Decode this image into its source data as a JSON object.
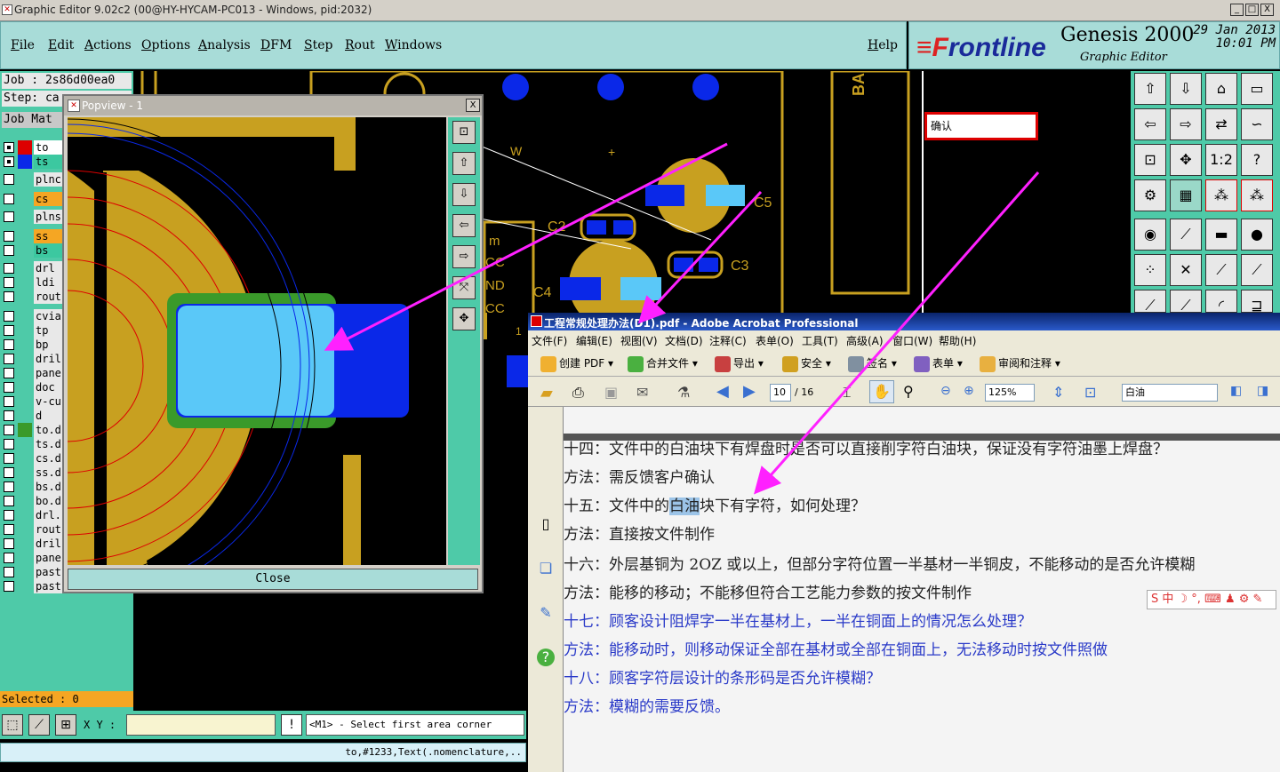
{
  "window": {
    "title": "Graphic Editor 9.02c2 (00@HY-HYCAM-PC013 - Windows, pid:2032)",
    "minimize": "_",
    "maximize": "□",
    "close": "X"
  },
  "menu": {
    "items": [
      "File",
      "Edit",
      "Actions",
      "Options",
      "Analysis",
      "DFM",
      "Step",
      "Rout",
      "Windows"
    ],
    "help": "Help"
  },
  "brand": {
    "logo_prefix": "≡F",
    "logo_rest": "rontline",
    "product": "Genesis 2000",
    "subtitle": "Graphic Editor",
    "date_line1": "29 Jan 2013",
    "date_line2": "10:01 PM"
  },
  "left": {
    "job": "Job : 2s86d00ea0",
    "step": "Step: ca",
    "job_matrix": "Job Mat",
    "layers": [
      {
        "name": "to",
        "color": "#ffffff",
        "checked": true
      },
      {
        "name": "ts",
        "color": "#3cc8a0",
        "checked": true
      },
      {
        "name": "plnc:",
        "color": "#e8e8e8",
        "checked": false
      },
      {
        "name": "cs",
        "color": "#f5a623",
        "checked": false
      },
      {
        "name": "plns:",
        "color": "#e8e8e8",
        "checked": false
      },
      {
        "name": "ss",
        "color": "#f5a623",
        "checked": false
      },
      {
        "name": "bs",
        "color": "#3cc8a0",
        "checked": false
      },
      {
        "name": "drl",
        "color": "#e8e8e8",
        "checked": false
      },
      {
        "name": "ldi",
        "color": "#e8e8e8",
        "checked": false
      },
      {
        "name": "rout",
        "color": "#e8e8e8",
        "checked": false
      },
      {
        "name": "cvia",
        "color": "#e8e8e8",
        "checked": false
      },
      {
        "name": "tp",
        "color": "#e8e8e8",
        "checked": false
      },
      {
        "name": "bp",
        "color": "#e8e8e8",
        "checked": false
      },
      {
        "name": "dril",
        "color": "#e8e8e8",
        "checked": false
      },
      {
        "name": "pane:",
        "color": "#e8e8e8",
        "checked": false
      },
      {
        "name": "doc",
        "color": "#e8e8e8",
        "checked": false
      },
      {
        "name": "v-cu",
        "color": "#e8e8e8",
        "checked": false
      },
      {
        "name": "d",
        "color": "#e8e8e8",
        "checked": false
      },
      {
        "name": "to.d",
        "color": "#e8e8e8",
        "checked": false
      },
      {
        "name": "ts.d",
        "color": "#e8e8e8",
        "checked": false
      },
      {
        "name": "cs.d",
        "color": "#e8e8e8",
        "checked": false
      },
      {
        "name": "ss.d",
        "color": "#e8e8e8",
        "checked": false
      },
      {
        "name": "bs.d",
        "color": "#e8e8e8",
        "checked": false
      },
      {
        "name": "bo.d",
        "color": "#e8e8e8",
        "checked": false
      },
      {
        "name": "drl.",
        "color": "#e8e8e8",
        "checked": false
      },
      {
        "name": "rout",
        "color": "#e8e8e8",
        "checked": false
      },
      {
        "name": "dril",
        "color": "#e8e8e8",
        "checked": false
      },
      {
        "name": "pane:",
        "color": "#e8e8e8",
        "checked": false
      },
      {
        "name": "past",
        "color": "#e8e8e8",
        "checked": false
      },
      {
        "name": "past",
        "color": "#e8e8e8",
        "checked": false
      }
    ],
    "selected": "Selected : 0"
  },
  "bottom": {
    "xy_label": "X Y :",
    "xy_value": "",
    "alert": "!",
    "message": "<M1> - Select first area corner",
    "status": "to,#1233,Text(.nomenclature,.."
  },
  "popview": {
    "title": "Popview - 1",
    "close_x": "X",
    "close_label": "Close"
  },
  "canvas_labels": {
    "w": "W",
    "plus": "+",
    "c5": "C5",
    "c2": "C2",
    "c3": "C3",
    "c4": "C4",
    "m": "m",
    "cc1": "CC",
    "nd": "ND",
    "cc2": "CC",
    "one": "1",
    "ba": "BA"
  },
  "right_tools": {
    "mid_label": "1:2",
    "help": "?"
  },
  "confirm": {
    "text": "确认"
  },
  "acrobat": {
    "title": "工程常规处理办法(D1).pdf - Adobe Acrobat Professional",
    "menu": [
      "文件(F)",
      "编辑(E)",
      "视图(V)",
      "文档(D)",
      "注释(C)",
      "表单(O)",
      "工具(T)",
      "高级(A)",
      "窗口(W)",
      "帮助(H)"
    ],
    "toolbar1": [
      "创建 PDF ▾",
      "合并文件 ▾",
      "导出 ▾",
      "安全 ▾",
      "签名 ▾",
      "表单 ▾",
      "审阅和注释 ▾"
    ],
    "page_current": "10",
    "page_total": "/ 16",
    "zoom": "125%",
    "search_value": "白油",
    "lines": [
      {
        "text": "十四：文件中的白油块下有焊盘时是否可以直接削字符白油块，保证没有字符油墨上焊盘？",
        "style": "q"
      },
      {
        "text": "方法：需反馈客户确认",
        "style": "q"
      },
      {
        "pre": "十五：文件中的",
        "hl": "白油",
        "post": "块下有字符，如何处理？",
        "style": "q"
      },
      {
        "text": "方法：直接按文件制作",
        "style": "q"
      },
      {
        "text": "十六：外层基铜为 2OZ 或以上，但部分字符位置一半基材一半铜皮，不能移动的是否允许模糊",
        "style": "q"
      },
      {
        "text": "方法：能移的移动；不能移但符合工艺能力参数的按文件制作",
        "style": "q"
      },
      {
        "text": "十七：顾客设计阻焊字一半在基材上，一半在铜面上的情况怎么处理？",
        "style": "blue"
      },
      {
        "text": "方法：能移动时，则移动保证全部在基材或全部在铜面上，无法移动时按文件照做",
        "style": "blue"
      },
      {
        "text": "十八：顾客字符层设计的条形码是否允许模糊？",
        "style": "blue"
      },
      {
        "text": "方法：模糊的需要反馈。",
        "style": "blue"
      }
    ]
  },
  "ime": {
    "text": "S 中 ☽ °, ⌨ ♟ ⚙ ✎"
  }
}
